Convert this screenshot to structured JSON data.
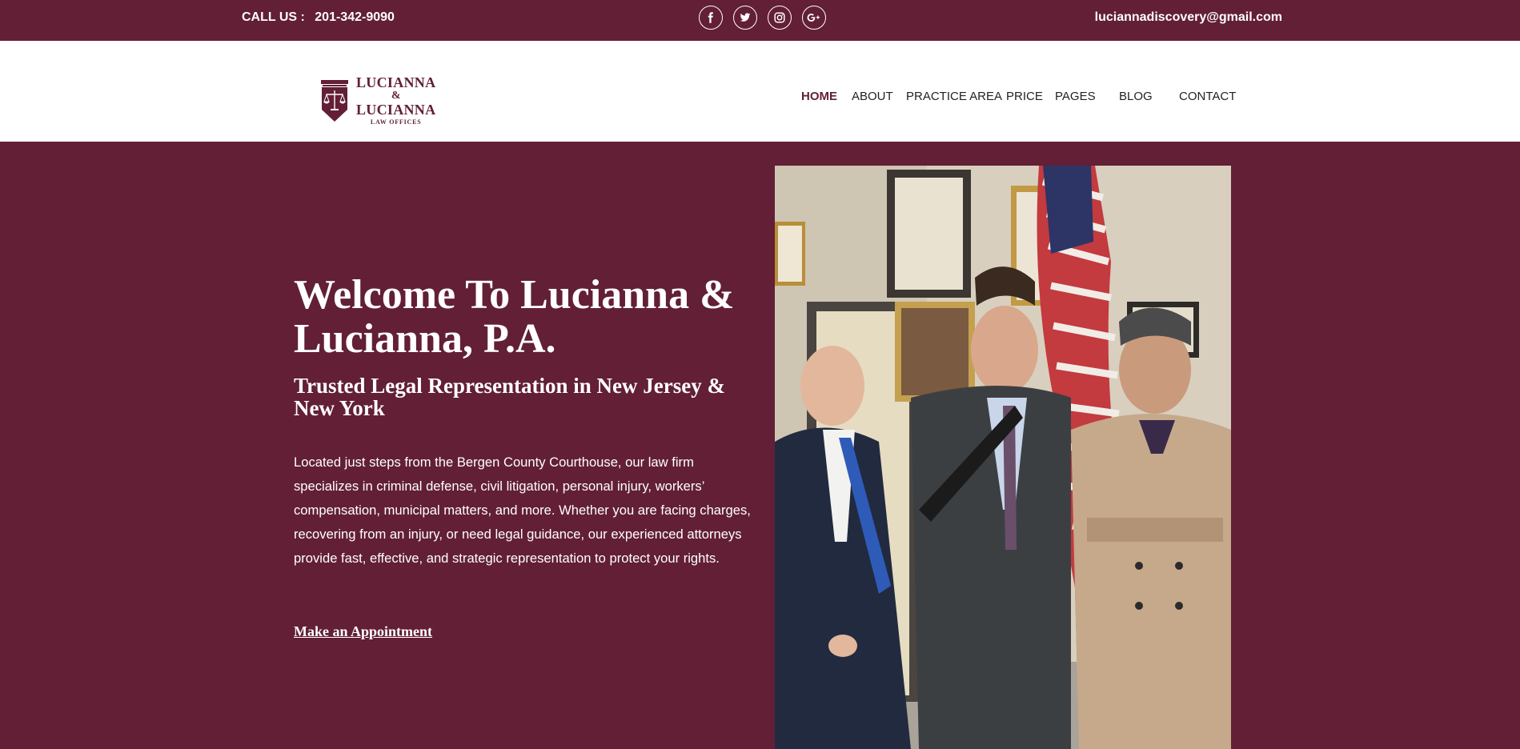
{
  "topbar": {
    "call_label": "CALL US :",
    "phone": "201-342-9090",
    "email": "luciannadiscovery@gmail.com",
    "social_icons": [
      "facebook-icon",
      "twitter-icon",
      "instagram-icon",
      "google-plus-icon"
    ]
  },
  "logo": {
    "line1": "LUCIANNA",
    "line2": "&",
    "line3": "LUCIANNA",
    "line4": "LAW OFFICES"
  },
  "nav": {
    "items": [
      {
        "label": "HOME",
        "active": true
      },
      {
        "label": "ABOUT"
      },
      {
        "label": "PRACTICE AREA"
      },
      {
        "label": "PRICE"
      },
      {
        "label": "PAGES"
      },
      {
        "label": "BLOG"
      },
      {
        "label": "CONTACT"
      }
    ]
  },
  "hero": {
    "title": "Welcome To Lucianna & Lucianna, P.A.",
    "subtitle": "Trusted Legal Representation in New Jersey & New York",
    "body": "Located just steps from the Bergen County Courthouse, our law firm specializes in criminal defense, civil litigation, personal injury, workers’ compensation, municipal matters, and more. Whether you are facing charges, recovering from an injury, or need legal guidance, our experienced attorneys provide fast, effective, and strategic representation to protect your rights.",
    "cta": "Make an Appointment"
  },
  "colors": {
    "brand": "#621f35",
    "white": "#ffffff",
    "nav_text": "#222222"
  }
}
